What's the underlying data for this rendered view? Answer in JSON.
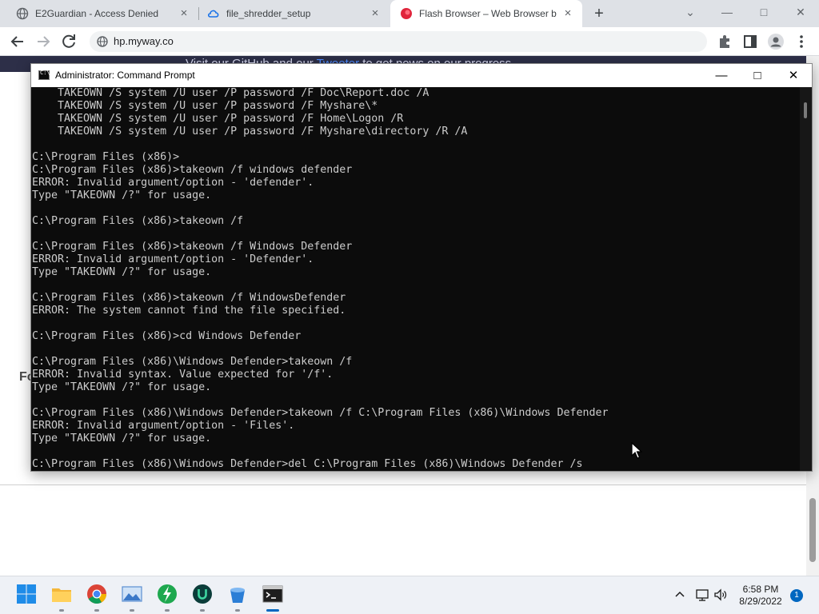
{
  "browser": {
    "tabs": [
      {
        "title": "E2Guardian - Access Denied",
        "icon": "globe-icon",
        "active": false
      },
      {
        "title": "file_shredder_setup",
        "icon": "cloud-icon",
        "active": false
      },
      {
        "title": "Flash Browser – Web Browser bu",
        "icon": "flash-browser-icon",
        "active": true
      }
    ],
    "tab_close": "×",
    "new_tab": "+",
    "window_controls": {
      "minimize": "—",
      "maximize": "□",
      "close": "✕",
      "tab_search": "⌄"
    },
    "url": "hp.myway.co"
  },
  "page": {
    "hero_part1": "Visit our GitHub and our ",
    "hero_link": "Tweeter",
    "hero_part2": " to get news on our progress.",
    "side_fragment": "Fo"
  },
  "cmd": {
    "title": "Administrator: Command Prompt",
    "controls": {
      "minimize": "—",
      "maximize": "□",
      "close": "✕"
    },
    "lines": [
      "    TAKEOWN /S system /U user /P password /F Doc\\Report.doc /A",
      "    TAKEOWN /S system /U user /P password /F Myshare\\*",
      "    TAKEOWN /S system /U user /P password /F Home\\Logon /R",
      "    TAKEOWN /S system /U user /P password /F Myshare\\directory /R /A",
      "",
      "C:\\Program Files (x86)>",
      "C:\\Program Files (x86)>takeown /f windows defender",
      "ERROR: Invalid argument/option - 'defender'.",
      "Type \"TAKEOWN /?\" for usage.",
      "",
      "C:\\Program Files (x86)>takeown /f",
      "",
      "C:\\Program Files (x86)>takeown /f Windows Defender",
      "ERROR: Invalid argument/option - 'Defender'.",
      "Type \"TAKEOWN /?\" for usage.",
      "",
      "C:\\Program Files (x86)>takeown /f WindowsDefender",
      "ERROR: The system cannot find the file specified.",
      "",
      "C:\\Program Files (x86)>cd Windows Defender",
      "",
      "C:\\Program Files (x86)\\Windows Defender>takeown /f",
      "ERROR: Invalid syntax. Value expected for '/f'.",
      "Type \"TAKEOWN /?\" for usage.",
      "",
      "C:\\Program Files (x86)\\Windows Defender>takeown /f C:\\Program Files (x86)\\Windows Defender",
      "ERROR: Invalid argument/option - 'Files'.",
      "Type \"TAKEOWN /?\" for usage.",
      "",
      "C:\\Program Files (x86)\\Windows Defender>del C:\\Program Files (x86)\\Windows Defender /s"
    ]
  },
  "taskbar": {
    "apps": [
      {
        "name": "start-icon",
        "active": false
      },
      {
        "name": "file-explorer-icon",
        "active": false
      },
      {
        "name": "chrome-icon",
        "active": false
      },
      {
        "name": "photos-icon",
        "active": false
      },
      {
        "name": "network-app-icon",
        "active": false
      },
      {
        "name": "u-app-icon",
        "active": false
      },
      {
        "name": "bucket-app-icon",
        "active": false
      },
      {
        "name": "command-prompt-icon",
        "active": true
      }
    ],
    "time": "6:58 PM",
    "date": "8/29/2022",
    "notification_count": "1"
  }
}
